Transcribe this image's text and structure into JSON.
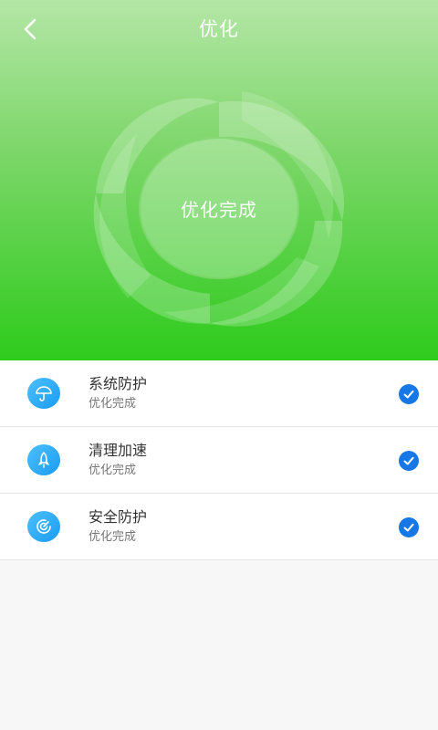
{
  "header": {
    "title": "优化",
    "back_icon": "chevron-left-icon"
  },
  "hero": {
    "status": "优化完成"
  },
  "items": [
    {
      "title": "系统防护",
      "subtitle": "优化完成",
      "icon": "umbrella-icon",
      "checked": true
    },
    {
      "title": "清理加速",
      "subtitle": "优化完成",
      "icon": "rocket-icon",
      "checked": true
    },
    {
      "title": "安全防护",
      "subtitle": "优化完成",
      "icon": "target-icon",
      "checked": true
    }
  ],
  "colors": {
    "accent_green": "#2ecb1c",
    "icon_blue": "#1a9bf0",
    "check_blue": "#1677e6"
  }
}
